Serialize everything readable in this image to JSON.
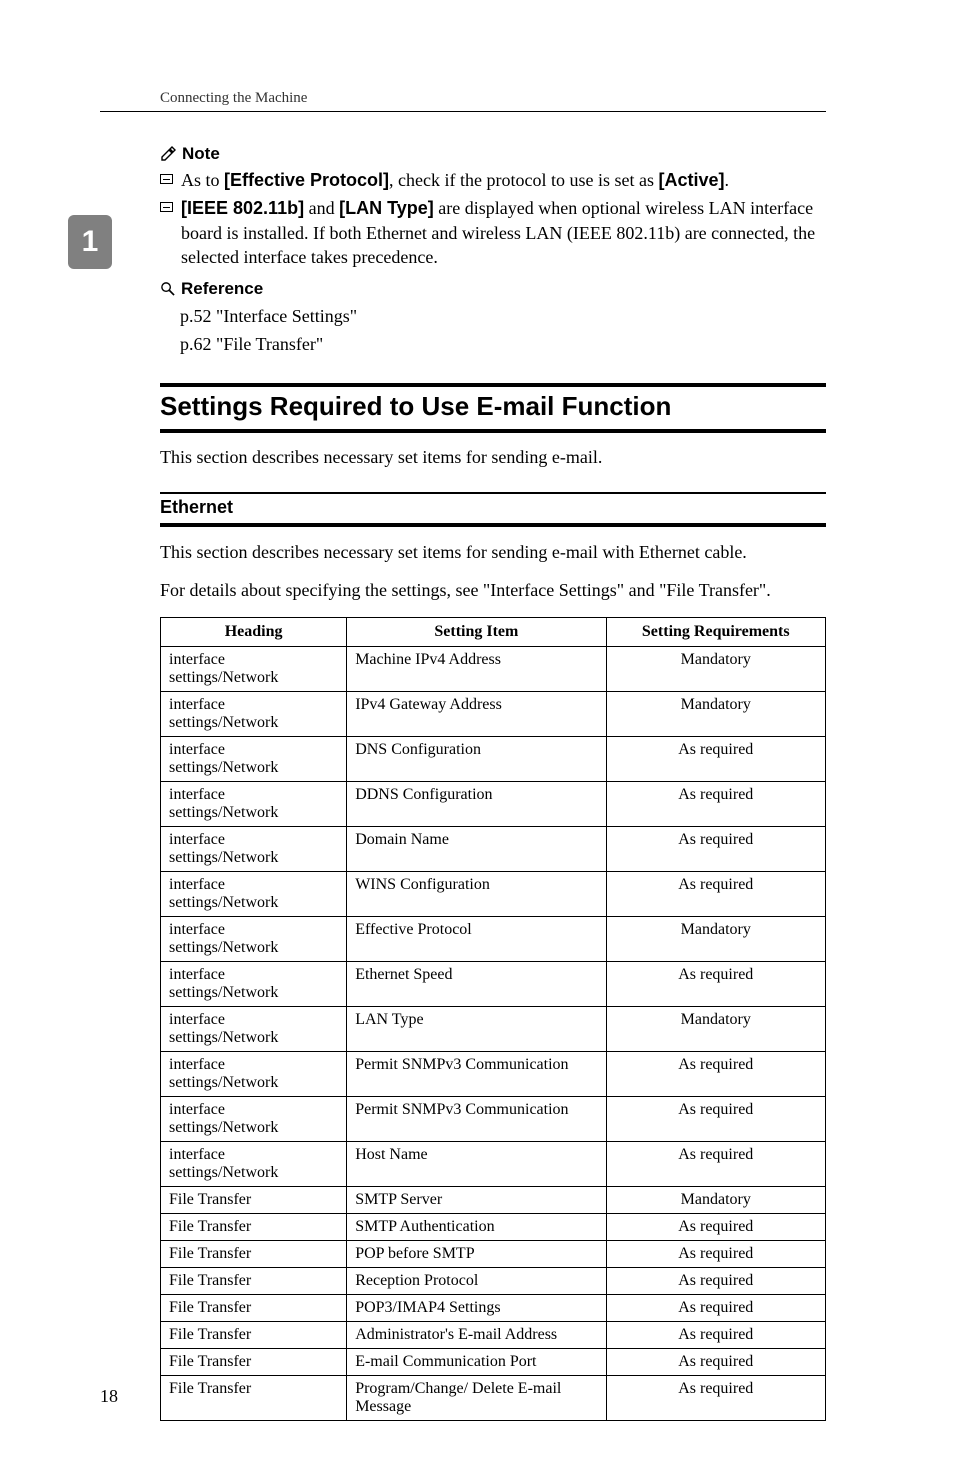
{
  "running_head": "Connecting the Machine",
  "section_tab": "1",
  "page_number": "18",
  "note": {
    "label": "Note",
    "items": [
      {
        "prefix": "As to ",
        "bold1": "[Effective Protocol]",
        "mid": ", check if the protocol to use is set as ",
        "bold2": "[Active]",
        "suffix": "."
      },
      {
        "bold1": "[IEEE 802.11b]",
        "mid1": " and ",
        "bold2": "[LAN Type]",
        "rest": " are displayed when optional wireless LAN interface board is installed. If both Ethernet and wireless LAN (IEEE 802.11b) are connected, the selected interface takes precedence."
      }
    ]
  },
  "reference": {
    "label": "Reference",
    "lines": [
      "p.52 \"Interface Settings\"",
      "p.62 \"File Transfer\""
    ]
  },
  "h2": "Settings Required to Use E-mail Function",
  "h2_intro": "This section describes necessary set items for sending e-mail.",
  "h3": "Ethernet",
  "h3_para1": "This section describes necessary set items for sending e-mail with Ethernet cable.",
  "h3_para2": "For details about specifying the settings, see \"Interface Settings\" and \"File Transfer\".",
  "table": {
    "headers": [
      "Heading",
      "Setting Item",
      "Setting Requirements"
    ],
    "rows": [
      [
        "interface settings/Network",
        "Machine IPv4 Address",
        "Mandatory"
      ],
      [
        "interface settings/Network",
        "IPv4 Gateway Address",
        "Mandatory"
      ],
      [
        "interface settings/Network",
        "DNS Configuration",
        "As required"
      ],
      [
        "interface settings/Network",
        "DDNS Configuration",
        "As required"
      ],
      [
        "interface settings/Network",
        "Domain Name",
        "As required"
      ],
      [
        "interface settings/Network",
        "WINS Configuration",
        "As required"
      ],
      [
        "interface settings/Network",
        "Effective Protocol",
        "Mandatory"
      ],
      [
        "interface settings/Network",
        "Ethernet Speed",
        "As required"
      ],
      [
        "interface settings/Network",
        "LAN Type",
        "Mandatory"
      ],
      [
        "interface settings/Network",
        "Permit SNMPv3 Communication",
        "As required"
      ],
      [
        "interface settings/Network",
        "Permit SNMPv3 Communication",
        "As required"
      ],
      [
        "interface settings/Network",
        "Host Name",
        "As required"
      ],
      [
        "File Transfer",
        "SMTP Server",
        "Mandatory"
      ],
      [
        "File Transfer",
        "SMTP Authentication",
        "As required"
      ],
      [
        "File Transfer",
        "POP before SMTP",
        "As required"
      ],
      [
        "File Transfer",
        "Reception Protocol",
        "As required"
      ],
      [
        "File Transfer",
        "POP3/IMAP4 Settings",
        "As required"
      ],
      [
        "File Transfer",
        "Administrator's E-mail Address",
        "As required"
      ],
      [
        "File Transfer",
        "E-mail Communication Port",
        "As required"
      ],
      [
        "File Transfer",
        "Program/Change/\nDelete E-mail Message",
        "As required"
      ]
    ]
  }
}
